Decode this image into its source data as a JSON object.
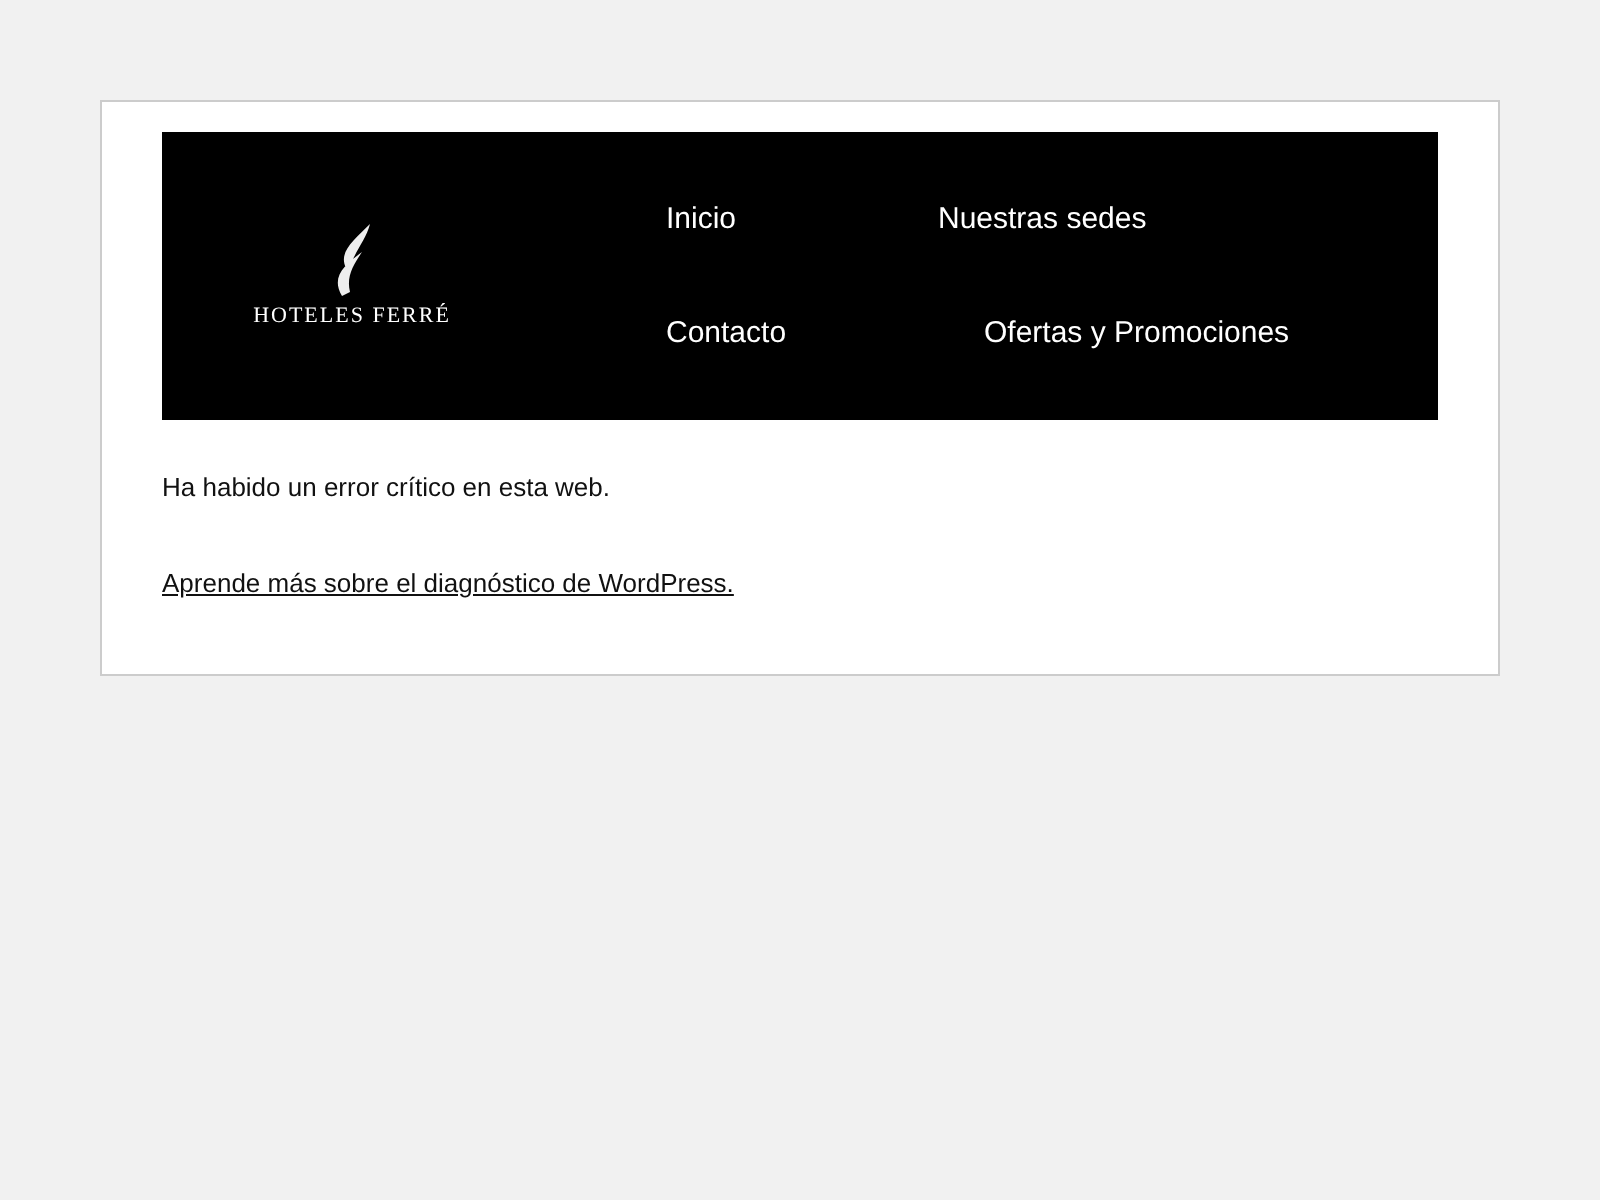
{
  "header": {
    "logo_text": "HOTELES FERRÉ",
    "nav": [
      {
        "label": "Inicio"
      },
      {
        "label": "Nuestras sedes"
      },
      {
        "label": "Contacto"
      },
      {
        "label": "Ofertas y Promociones"
      }
    ]
  },
  "message": "Ha habido un error crítico en esta web.",
  "link": "Aprende más sobre el diagnóstico de WordPress."
}
